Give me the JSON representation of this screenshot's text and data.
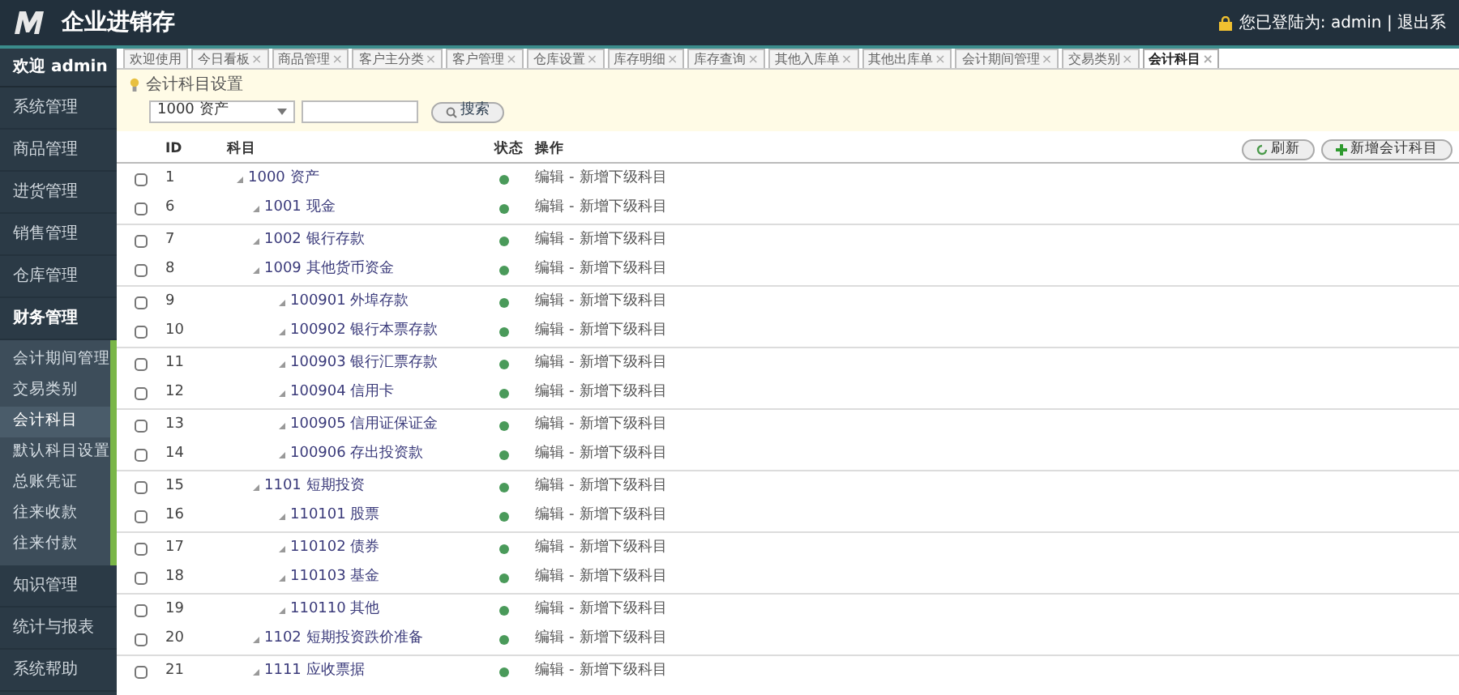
{
  "header": {
    "title": "企业进销存",
    "user_info": "您已登陆为: admin | 退出系"
  },
  "sidebar": {
    "welcome": "欢迎 admin",
    "items": [
      {
        "label": "系统管理",
        "expanded": false
      },
      {
        "label": "商品管理",
        "expanded": false
      },
      {
        "label": "进货管理",
        "expanded": false
      },
      {
        "label": "销售管理",
        "expanded": false
      },
      {
        "label": "仓库管理",
        "expanded": false
      },
      {
        "label": "财务管理",
        "expanded": true,
        "children": [
          {
            "label": "会计期间管理",
            "selected": false
          },
          {
            "label": "交易类别",
            "selected": false
          },
          {
            "label": "会计科目",
            "selected": true
          },
          {
            "label": "默认科目设置",
            "selected": false
          },
          {
            "label": "总账凭证",
            "selected": false
          },
          {
            "label": "往来收款",
            "selected": false
          },
          {
            "label": "往来付款",
            "selected": false
          }
        ]
      },
      {
        "label": "知识管理",
        "expanded": false
      },
      {
        "label": "统计与报表",
        "expanded": false
      },
      {
        "label": "系统帮助",
        "expanded": false
      }
    ]
  },
  "tabs": [
    {
      "label": "欢迎使用",
      "selected": false
    },
    {
      "label": "今日看板",
      "close": "×",
      "selected": false
    },
    {
      "label": "商品管理",
      "close": "×",
      "selected": false
    },
    {
      "label": "客户主分类",
      "close": "×",
      "selected": false
    },
    {
      "label": "客户管理",
      "close": "×",
      "selected": false
    },
    {
      "label": "仓库设置",
      "close": "×",
      "selected": false
    },
    {
      "label": "库存明细",
      "close": "×",
      "selected": false
    },
    {
      "label": "库存查询",
      "close": "×",
      "selected": false
    },
    {
      "label": "其他入库单",
      "close": "×",
      "selected": false
    },
    {
      "label": "其他出库单",
      "close": "×",
      "selected": false
    },
    {
      "label": "会计期间管理",
      "close": "×",
      "selected": false
    },
    {
      "label": "交易类别",
      "close": "×",
      "selected": false
    },
    {
      "label": "会计科目",
      "close": "×",
      "selected": true
    }
  ],
  "panel": {
    "title": "会计科目设置",
    "filter_value": "1000 资产",
    "search_button": "搜索"
  },
  "toolbar": {
    "buttons": [
      "刷新",
      "新增会计科目"
    ]
  },
  "table": {
    "columns": [
      "ID",
      "科目",
      "状态",
      "操作"
    ],
    "rows": [
      {
        "id": "1",
        "name": "1000 资产",
        "checked": false,
        "active": true,
        "actions": [
          "编辑",
          "-",
          "新增下级科目"
        ],
        "children": [
          {
            "id": "6",
            "name": "1001 现金",
            "checked": false,
            "active": true,
            "actions": [
              "编辑",
              "-",
              "新增下级科目"
            ]
          },
          {
            "id": "7",
            "name": "1002 银行存款",
            "checked": false,
            "active": true,
            "actions": [
              "编辑",
              "-",
              "新增下级科目"
            ]
          },
          {
            "id": "8",
            "name": "1009 其他货币资金",
            "checked": false,
            "active": true,
            "actions": [
              "编辑",
              "-",
              "新增下级科目"
            ],
            "children": [
              {
                "id": "9",
                "name": "100901 外埠存款",
                "checked": false,
                "active": true,
                "actions": [
                  "编辑",
                  "-",
                  "新增下级科目"
                ]
              },
              {
                "id": "10",
                "name": "100902 银行本票存款",
                "checked": false,
                "active": true,
                "actions": [
                  "编辑",
                  "-",
                  "新增下级科目"
                ]
              },
              {
                "id": "11",
                "name": "100903 银行汇票存款",
                "checked": false,
                "active": true,
                "actions": [
                  "编辑",
                  "-",
                  "新增下级科目"
                ]
              },
              {
                "id": "12",
                "name": "100904 信用卡",
                "checked": false,
                "active": true,
                "actions": [
                  "编辑",
                  "-",
                  "新增下级科目"
                ]
              },
              {
                "id": "13",
                "name": "100905 信用证保证金",
                "checked": false,
                "active": true,
                "actions": [
                  "编辑",
                  "-",
                  "新增下级科目"
                ]
              },
              {
                "id": "14",
                "name": "100906 存出投资款",
                "checked": false,
                "active": true,
                "actions": [
                  "编辑",
                  "-",
                  "新增下级科目"
                ]
              }
            ]
          },
          {
            "id": "15",
            "name": "1101 短期投资",
            "checked": false,
            "active": true,
            "actions": [
              "编辑",
              "-",
              "新增下级科目"
            ],
            "children": [
              {
                "id": "16",
                "name": "110101 股票",
                "checked": false,
                "active": true,
                "actions": [
                  "编辑",
                  "-",
                  "新增下级科目"
                ]
              },
              {
                "id": "17",
                "name": "110102 债券",
                "checked": false,
                "active": true,
                "actions": [
                  "编辑",
                  "-",
                  "新增下级科目"
                ]
              },
              {
                "id": "18",
                "name": "110103 基金",
                "checked": false,
                "active": true,
                "actions": [
                  "编辑",
                  "-",
                  "新增下级科目"
                ]
              },
              {
                "id": "19",
                "name": "110110 其他",
                "checked": false,
                "active": true,
                "actions": [
                  "编辑",
                  "-",
                  "新增下级科目"
                ]
              }
            ]
          },
          {
            "id": "20",
            "name": "1102 短期投资跌价准备",
            "checked": false,
            "active": true,
            "actions": [
              "编辑",
              "-",
              "新增下级科目"
            ]
          },
          {
            "id": "21",
            "name": "1111 应收票据",
            "checked": false,
            "active": true,
            "actions": [
              "编辑",
              "-",
              "新增下级科目"
            ]
          }
        ]
      }
    ]
  }
}
